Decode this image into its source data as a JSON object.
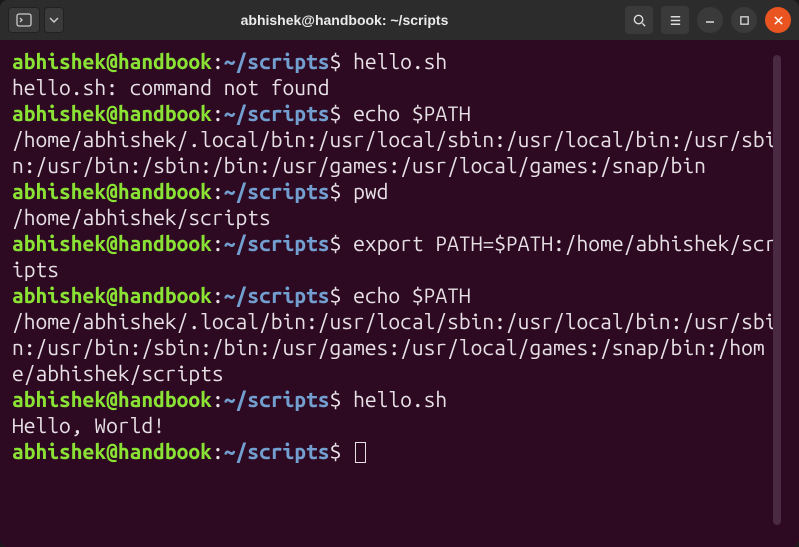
{
  "titlebar": {
    "title": "abhishek@handbook: ~/scripts"
  },
  "prompt": {
    "user": "abhishek",
    "at": "@",
    "host": "handbook",
    "colon": ":",
    "path": "~/scripts",
    "dollar": "$"
  },
  "lines": [
    {
      "type": "cmd",
      "command": "hello.sh"
    },
    {
      "type": "out",
      "text": "hello.sh: command not found"
    },
    {
      "type": "cmd",
      "command": "echo $PATH"
    },
    {
      "type": "out",
      "text": "/home/abhishek/.local/bin:/usr/local/sbin:/usr/local/bin:/usr/sbin:/usr/bin:/sbin:/bin:/usr/games:/usr/local/games:/snap/bin"
    },
    {
      "type": "cmd",
      "command": "pwd"
    },
    {
      "type": "out",
      "text": "/home/abhishek/scripts"
    },
    {
      "type": "cmd",
      "command": "export PATH=$PATH:/home/abhishek/scripts"
    },
    {
      "type": "cmd",
      "command": "echo $PATH"
    },
    {
      "type": "out",
      "text": "/home/abhishek/.local/bin:/usr/local/sbin:/usr/local/bin:/usr/sbin:/usr/bin:/sbin:/bin:/usr/games:/usr/local/games:/snap/bin:/home/abhishek/scripts"
    },
    {
      "type": "cmd",
      "command": "hello.sh"
    },
    {
      "type": "out",
      "text": "Hello, World!"
    },
    {
      "type": "cmd",
      "command": "",
      "cursor": true
    }
  ]
}
